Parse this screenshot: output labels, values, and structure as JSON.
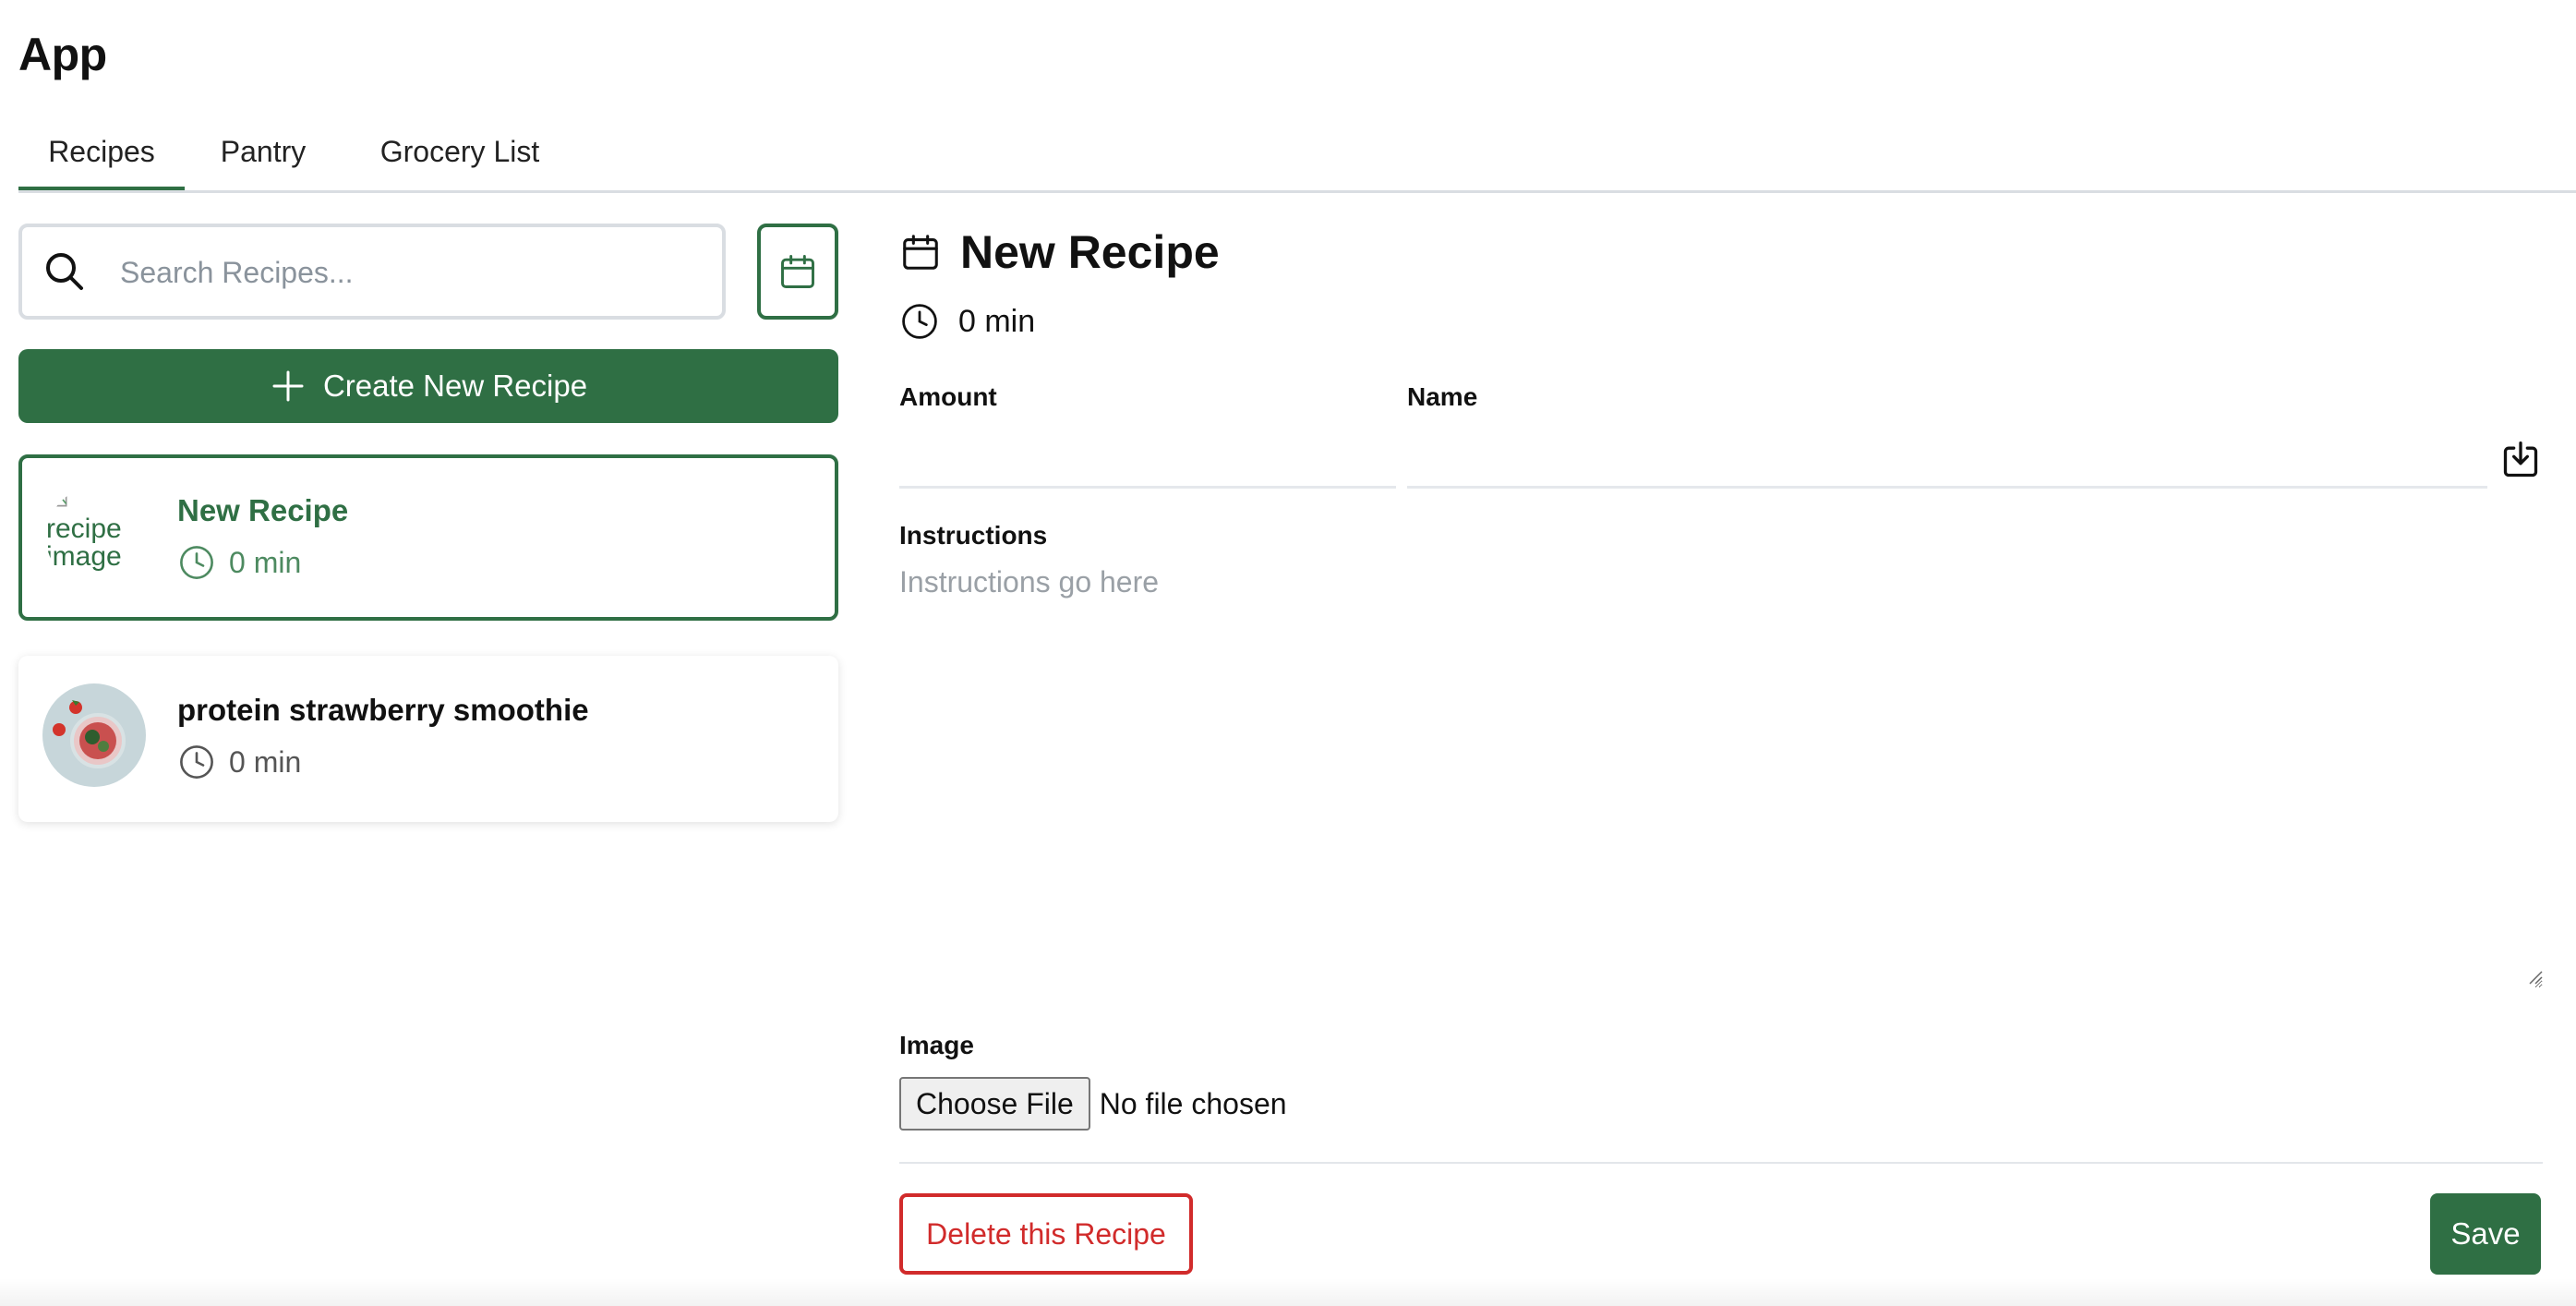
{
  "app": {
    "title": "App"
  },
  "tabs": [
    {
      "label": "Recipes",
      "active": true
    },
    {
      "label": "Pantry",
      "active": false
    },
    {
      "label": "Grocery List",
      "active": false
    }
  ],
  "sidebar": {
    "search_placeholder": "Search Recipes...",
    "search_value": "",
    "calendar_icon": "calendar-icon",
    "create_label": "Create New Recipe",
    "recipes": [
      {
        "title": "New Recipe",
        "time": "0 min",
        "image_alt": "recipe image",
        "selected": true
      },
      {
        "title": "protein strawberry smoothie",
        "time": "0 min",
        "image_alt": "recipe image",
        "selected": false
      }
    ]
  },
  "detail": {
    "title": "New Recipe",
    "time": "0 min",
    "amount_label": "Amount",
    "name_label": "Name",
    "amount_value": "",
    "name_value": "",
    "instructions_label": "Instructions",
    "instructions_placeholder": "Instructions go here",
    "image_label": "Image",
    "choose_file_label": "Choose File",
    "no_file_label": "No file chosen",
    "delete_label": "Delete this Recipe",
    "save_label": "Save"
  },
  "colors": {
    "accent": "#2f6f44",
    "danger": "#d12b2b",
    "border": "#d9dde2"
  }
}
